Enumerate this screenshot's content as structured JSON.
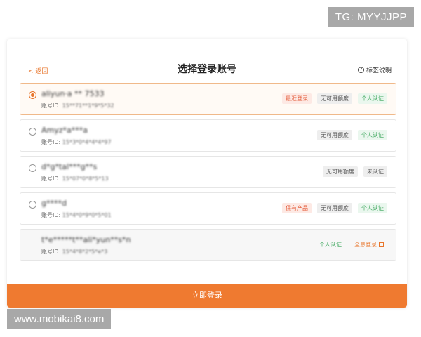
{
  "watermarks": {
    "tg": "TG: MYYJJPP",
    "site": "www.mobikai8.com"
  },
  "header": {
    "back": "< 返回",
    "title": "选择登录账号",
    "help": "标签说明",
    "help_icon": "?"
  },
  "id_prefix": "账号ID: ",
  "accounts": [
    {
      "name": "aliyun·a ** 7533",
      "id": "15**71**1*9*5*32",
      "tags": [
        "最近登录",
        "无可用额度",
        "个人认证"
      ]
    },
    {
      "name": "Amyz*a***a",
      "id": "15*3*0*4*4*4*97",
      "tags": [
        "无可用额度",
        "个人认证"
      ]
    },
    {
      "name": "d*g*tal***g**s",
      "id": "15*07*0*8*5*13",
      "tags": [
        "无可用额度",
        "未认证"
      ]
    },
    {
      "name": "g****d",
      "id": "15*4*0*9*0*5*01",
      "tags": [
        "保有产品",
        "无可用额度",
        "个人认证"
      ]
    },
    {
      "name": "t*e*****t**ali*yun**s*n",
      "id": "15*4*8*2*5*e*3",
      "tags": [
        "个人认证",
        "全息登录"
      ]
    }
  ],
  "login_button": "立即登录",
  "colors": {
    "accent": "#ef7a30",
    "green": "#3aa55a",
    "red": "#e45c3a"
  }
}
